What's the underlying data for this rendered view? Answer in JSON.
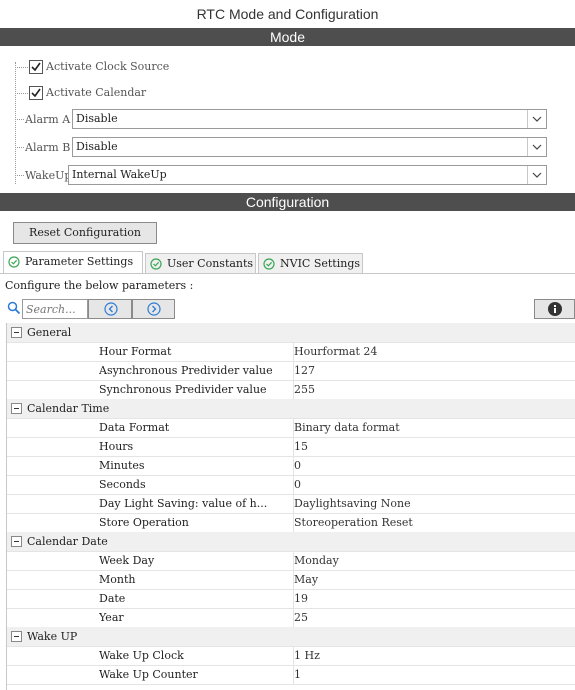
{
  "window_title": "RTC Mode and Configuration",
  "mode_section": {
    "header": "Mode",
    "checkboxes": [
      {
        "label": "Activate Clock Source",
        "checked": true
      },
      {
        "label": "Activate Calendar",
        "checked": true
      }
    ],
    "fields": [
      {
        "label": "Alarm A",
        "value": "Disable"
      },
      {
        "label": "Alarm B",
        "value": "Disable"
      },
      {
        "label": "WakeUp",
        "value": "Internal WakeUp"
      }
    ]
  },
  "config_section": {
    "header": "Configuration",
    "reset_button": "Reset Configuration",
    "tabs": [
      "Parameter Settings",
      "User Constants",
      "NVIC Settings"
    ],
    "active_tab": "Parameter Settings",
    "instruction": "Configure the below parameters :",
    "search_placeholder": "Search..."
  },
  "parameters": [
    {
      "group": "General",
      "rows": [
        {
          "name": "Hour Format",
          "value": "Hourformat 24"
        },
        {
          "name": "Asynchronous Predivider value",
          "value": "127"
        },
        {
          "name": "Synchronous Predivider value",
          "value": "255"
        }
      ]
    },
    {
      "group": "Calendar Time",
      "rows": [
        {
          "name": "Data Format",
          "value": "Binary data format"
        },
        {
          "name": "Hours",
          "value": "15"
        },
        {
          "name": "Minutes",
          "value": "0"
        },
        {
          "name": "Seconds",
          "value": "0"
        },
        {
          "name": "Day Light Saving: value of h...",
          "value": "Daylightsaving None"
        },
        {
          "name": "Store Operation",
          "value": "Storeoperation Reset"
        }
      ]
    },
    {
      "group": "Calendar Date",
      "rows": [
        {
          "name": "Week Day",
          "value": "Monday"
        },
        {
          "name": "Month",
          "value": "May"
        },
        {
          "name": "Date",
          "value": "19"
        },
        {
          "name": "Year",
          "value": "25"
        }
      ]
    },
    {
      "group": "Wake UP",
      "rows": [
        {
          "name": "Wake Up Clock",
          "value": "1 Hz"
        },
        {
          "name": "Wake Up Counter",
          "value": "1"
        }
      ]
    }
  ]
}
